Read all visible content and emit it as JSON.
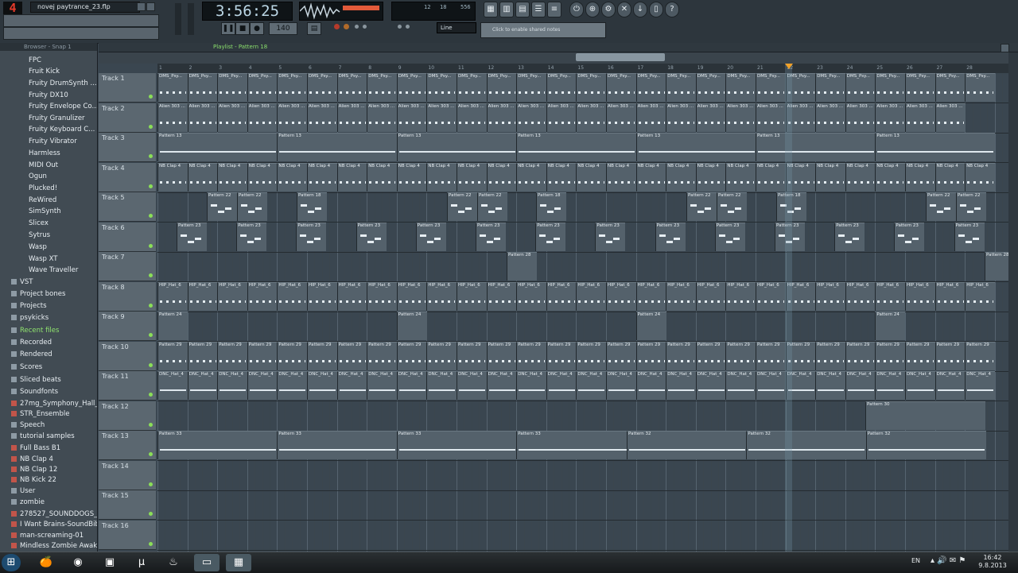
{
  "app": {
    "pattern_number": "4",
    "project_file": "novej paytrance_23.flp",
    "time": "3:56:25",
    "mode": "Line",
    "hint": "Click to enable shared notes"
  },
  "cpu": {
    "value": "556",
    "value2": "12",
    "value3": "18"
  },
  "browser": {
    "header": "Browser - Snap 1",
    "items": [
      {
        "label": "FPC",
        "sel": false
      },
      {
        "label": "Fruit Kick",
        "sel": false
      },
      {
        "label": "Fruity DrumSynth ...",
        "sel": false
      },
      {
        "label": "Fruity DX10",
        "sel": false
      },
      {
        "label": "Fruity Envelope Co...",
        "sel": false
      },
      {
        "label": "Fruity Granulizer",
        "sel": false
      },
      {
        "label": "Fruity Keyboard C...",
        "sel": false
      },
      {
        "label": "Fruity Vibrator",
        "sel": false
      },
      {
        "label": "Harmless",
        "sel": false
      },
      {
        "label": "MIDI Out",
        "sel": false
      },
      {
        "label": "Ogun",
        "sel": false
      },
      {
        "label": "Plucked!",
        "sel": false
      },
      {
        "label": "ReWired",
        "sel": false
      },
      {
        "label": "SimSynth",
        "sel": false
      },
      {
        "label": "Slicex",
        "sel": false
      },
      {
        "label": "Sytrus",
        "sel": false
      },
      {
        "label": "Wasp",
        "sel": false
      },
      {
        "label": "Wasp XT",
        "sel": false
      },
      {
        "label": "Wave Traveller",
        "sel": false
      },
      {
        "label": "VST",
        "sel": false
      },
      {
        "label": "Project bones",
        "sel": false
      },
      {
        "label": "Projects",
        "sel": false
      },
      {
        "label": "psykicks",
        "sel": false
      },
      {
        "label": "Recent files",
        "sel": true
      },
      {
        "label": "Recorded",
        "sel": false
      },
      {
        "label": "Rendered",
        "sel": false
      },
      {
        "label": "Scores",
        "sel": false
      },
      {
        "label": "Sliced beats",
        "sel": false
      },
      {
        "label": "Soundfonts",
        "sel": false
      },
      {
        "label": "27mg_Symphony_Hall_...",
        "sel": false
      },
      {
        "label": "STR_Ensemble",
        "sel": false
      },
      {
        "label": "Speech",
        "sel": false
      },
      {
        "label": "tutorial samples",
        "sel": false
      },
      {
        "label": "Full Bass B1",
        "sel": false
      },
      {
        "label": "NB Clap 4",
        "sel": false
      },
      {
        "label": "NB Clap 12",
        "sel": false
      },
      {
        "label": "NB Kick 22",
        "sel": false
      },
      {
        "label": "User",
        "sel": false
      },
      {
        "label": "zombie",
        "sel": false
      },
      {
        "label": "278527_SOUNDDOGS_...",
        "sel": false
      },
      {
        "label": "I Want Brains-SoundBibl...",
        "sel": false
      },
      {
        "label": "man-screaming-01",
        "sel": false
      },
      {
        "label": "Mindless Zombie Awake...",
        "sel": false
      }
    ]
  },
  "playlist": {
    "title": "Playlist - Pattern 18",
    "ruler": [
      "1",
      "2",
      "3",
      "4",
      "5",
      "6",
      "7",
      "8",
      "9",
      "10",
      "11",
      "12",
      "13",
      "14",
      "15",
      "16",
      "17",
      "18",
      "19",
      "20",
      "21",
      "22",
      "23",
      "24",
      "25",
      "26",
      "27",
      "28"
    ],
    "tracks": [
      "Track 1",
      "Track 2",
      "Track 3",
      "Track 4",
      "Track 5",
      "Track 6",
      "Track 7",
      "Track 8",
      "Track 9",
      "Track 10",
      "Track 11",
      "Track 12",
      "Track 13",
      "Track 14",
      "Track 15",
      "Track 16"
    ]
  },
  "clips": {
    "t1": "DMS_Psy...",
    "t2": "Alien 303 ...",
    "t3": "Pattern 13",
    "t4": "NB Clap 4",
    "t5a": "Pattern 22",
    "t5b": "Pattern 18",
    "t6": "Pattern 23",
    "t7": "Pattern 28",
    "t8": "HIP_Hat_6",
    "t9": "Pattern 24",
    "t10": "Pattern 29",
    "t11": "DNC_Hat_4",
    "t12": "Pattern 30",
    "t13a": "Pattern 33",
    "t13b": "Pattern 32"
  },
  "taskbar": {
    "lang": "EN",
    "time": "16:42",
    "date": "9.8.2013"
  }
}
